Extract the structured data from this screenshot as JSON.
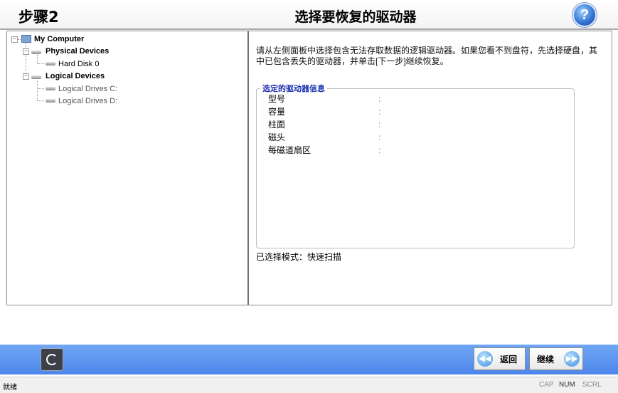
{
  "header": {
    "step": "步骤2",
    "title": "选择要恢复的驱动器",
    "help": "?"
  },
  "tree": {
    "root": "My Computer",
    "physical": "Physical Devices",
    "hard_disk": "Hard Disk 0",
    "logical": "Logical Devices",
    "drive_c": "Logical Drives C:",
    "drive_d": "Logical Drives D:"
  },
  "right": {
    "instruction": "请从左侧面板中选择包含无法存取数据的逻辑驱动器。如果您看不到盘符，先选择硬盘，其中已包含丢失的驱动器，并单击[下一步]继续恢复。",
    "group_title": "选定的驱动器信息",
    "props": [
      {
        "label": "型号",
        "value": ":"
      },
      {
        "label": "容量",
        "value": ":"
      },
      {
        "label": "柱面",
        "value": ":"
      },
      {
        "label": "磁头",
        "value": ":"
      },
      {
        "label": "每磁道扇区",
        "value": ":"
      }
    ],
    "mode": "已选择模式：快速扫描"
  },
  "footer": {
    "back": "返回",
    "next": "继续"
  },
  "status": {
    "left": "就绪",
    "cap": "CAP",
    "num": "NUM",
    "scrl": "SCRL"
  },
  "colors": {
    "footer_blue": "#5b93ee",
    "legend_blue": "#1a2fb0"
  }
}
